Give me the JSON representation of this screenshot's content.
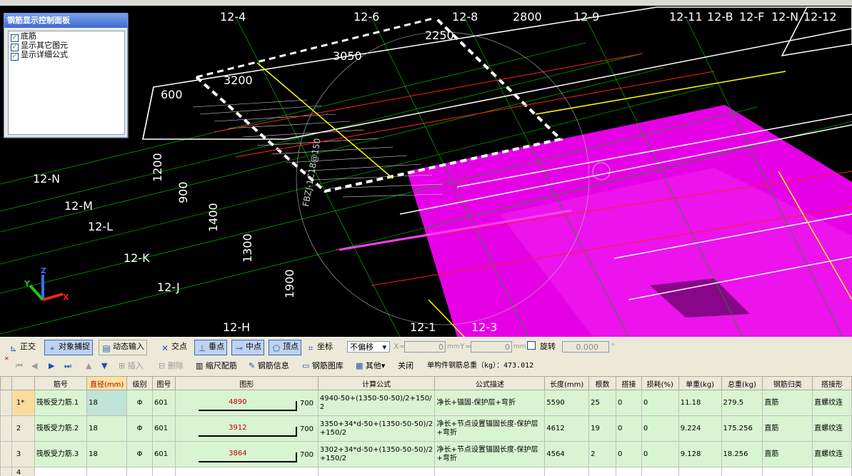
{
  "viewport": {
    "axis_labels_top": [
      "12-4",
      "12-6",
      "12-8",
      "12-9",
      "12-11",
      "12-B",
      "12-F",
      "12-N",
      "12-12"
    ],
    "axis_labels_left": [
      "12-N",
      "12-M",
      "12-L",
      "12-K",
      "12-J",
      "12-H"
    ],
    "axis_labels_bottom": [
      "12-1",
      "12-3"
    ],
    "dimensions": [
      "2800",
      "2250",
      "3050",
      "3200",
      "600",
      "1200",
      "900",
      "1400",
      "1300",
      "1900"
    ],
    "rebar_annotation": "FBZJ-1C18@150",
    "axes_triad": {
      "x": "X",
      "y": "Y",
      "z": "Z"
    }
  },
  "display_panel": {
    "title": "钢筋显示控制面板",
    "options": [
      {
        "label": "底筋",
        "checked": true
      },
      {
        "label": "显示其它图元",
        "checked": true
      },
      {
        "label": "显示详细公式",
        "checked": true
      }
    ]
  },
  "snap_toolbar": {
    "ortho": "正交",
    "object_snap": "对象捕捉",
    "dynamic_input": "动态输入",
    "intersection": "交点",
    "perpendicular": "垂点",
    "midpoint": "中点",
    "vertex": "顶点",
    "coordinate": "坐标",
    "offset_mode": "不偏移",
    "x_label": "X=",
    "x_value": "0",
    "y_label": "Y=",
    "y_value": "0",
    "unit": "mm",
    "rotate_label": "旋转",
    "rotate_value": "0.000",
    "degree": "°"
  },
  "edit_toolbar": {
    "insert": "插入",
    "delete": "删除",
    "scale_rebar": "缩尺配筋",
    "rebar_info": "钢筋信息",
    "rebar_library": "钢筋图库",
    "other": "其他",
    "close": "关闭",
    "total_weight": "单构件钢筋总重（kg）：473.012"
  },
  "table": {
    "headers": [
      "",
      "筋号",
      "直径(mm)",
      "级别",
      "图号",
      "图形",
      "计算公式",
      "公式描述",
      "长度(mm)",
      "根数",
      "搭接",
      "损耗(%)",
      "单重(kg)",
      "总重(kg)",
      "钢筋归类",
      "搭接形"
    ],
    "rows": [
      {
        "row": "1*",
        "name": "筏板受力筋.1",
        "diameter": "18",
        "grade": "Φ",
        "fig": "601",
        "shape_len": "4890",
        "shape_hook": "700",
        "formula": "4940-50+(1350-50-50)/2+150/2",
        "desc": "净长+锚固-保护层+弯折",
        "length": "5590",
        "count": "25",
        "lap": "0",
        "loss": "0",
        "unit_wt": "11.18",
        "total_wt": "279.5",
        "category": "直筋",
        "lap_type": "直螺纹连"
      },
      {
        "row": "2",
        "name": "筏板受力筋.2",
        "diameter": "18",
        "grade": "Φ",
        "fig": "601",
        "shape_len": "3912",
        "shape_hook": "700",
        "formula": "3350+34*d-50+(1350-50-50)/2+150/2",
        "desc": "净长+节点设置锚固长度-保护层+弯折",
        "length": "4612",
        "count": "19",
        "lap": "0",
        "loss": "0",
        "unit_wt": "9.224",
        "total_wt": "175.256",
        "category": "直筋",
        "lap_type": "直螺纹连"
      },
      {
        "row": "3",
        "name": "筏板受力筋.3",
        "diameter": "18",
        "grade": "Φ",
        "fig": "601",
        "shape_len": "3864",
        "shape_hook": "700",
        "formula": "3302+34*d-50+(1350-50-50)/2+150/2",
        "desc": "净长+节点设置锚固长度-保护层+弯折",
        "length": "4564",
        "count": "2",
        "lap": "0",
        "loss": "0",
        "unit_wt": "9.128",
        "total_wt": "18.256",
        "category": "直筋",
        "lap_type": "直螺纹连"
      }
    ],
    "empty_row": "4"
  }
}
